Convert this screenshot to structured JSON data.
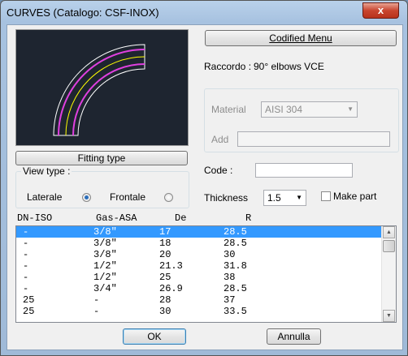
{
  "window": {
    "title": "CURVES (Catalogo: CSF-INOX)",
    "close_glyph": "x"
  },
  "buttons": {
    "codified_menu": "Codified Menu",
    "fitting_type": "Fitting type",
    "ok": "OK",
    "cancel": "Annulla"
  },
  "raccordo": {
    "label": "Raccordo :",
    "value": "90° elbows  VCE"
  },
  "material": {
    "label": "Material",
    "value": "AISI 304",
    "add_label": "Add",
    "add_value": ""
  },
  "view_type": {
    "label": "View type  :",
    "lateral": "Laterale",
    "frontal": "Frontale",
    "selected": "Laterale"
  },
  "code": {
    "label": "Code   :",
    "value": ""
  },
  "thickness": {
    "label": "Thickness",
    "value": "1.5"
  },
  "make_part": {
    "label": "Make part",
    "checked": false
  },
  "table": {
    "headers": [
      "DN-ISO",
      "Gas-ASA",
      "De",
      "R"
    ],
    "rows": [
      [
        "-",
        "3/8\"",
        "17",
        "28.5"
      ],
      [
        "-",
        "3/8\"",
        "18",
        "28.5"
      ],
      [
        "-",
        "3/8\"",
        "20",
        "30"
      ],
      [
        "-",
        "1/2\"",
        "21.3",
        "31.8"
      ],
      [
        "-",
        "1/2\"",
        "25",
        "38"
      ],
      [
        "-",
        "3/4\"",
        "26.9",
        "28.5"
      ],
      [
        "25",
        "-",
        "28",
        "37"
      ],
      [
        "25",
        "-",
        "30",
        "33.5"
      ]
    ],
    "selected_index": 0
  },
  "colors": {
    "preview_bg": "#1e2530",
    "outline": "#ffffff",
    "inner_wall": "#e040e0",
    "centerline": "#ffff00",
    "selection": "#3399ff"
  }
}
